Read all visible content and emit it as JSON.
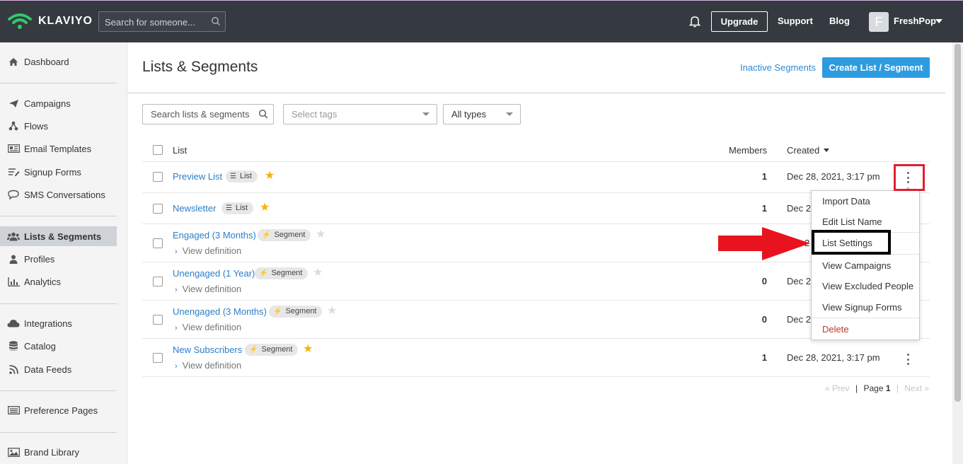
{
  "app": {
    "brand": "KLAVIYO",
    "brand_color": "#34c76b"
  },
  "topbar": {
    "search_placeholder": "Search for someone...",
    "upgrade_label": "Upgrade",
    "support_label": "Support",
    "blog_label": "Blog",
    "avatar_initial": "F",
    "account_name": "FreshPop"
  },
  "sidebar": {
    "items": [
      {
        "label": "Dashboard",
        "icon": "home-icon"
      },
      {
        "label": "Campaigns",
        "icon": "paper-plane-icon"
      },
      {
        "label": "Flows",
        "icon": "flows-icon"
      },
      {
        "label": "Email Templates",
        "icon": "newspaper-icon"
      },
      {
        "label": "Signup Forms",
        "icon": "form-list-icon"
      },
      {
        "label": "SMS Conversations",
        "icon": "chat-bubble-icon"
      },
      {
        "label": "Lists & Segments",
        "icon": "users-icon",
        "active": true
      },
      {
        "label": "Profiles",
        "icon": "user-icon"
      },
      {
        "label": "Analytics",
        "icon": "bar-chart-icon"
      },
      {
        "label": "Integrations",
        "icon": "cloud-icon"
      },
      {
        "label": "Catalog",
        "icon": "database-icon"
      },
      {
        "label": "Data Feeds",
        "icon": "rss-icon"
      },
      {
        "label": "Preference Pages",
        "icon": "list-page-icon"
      },
      {
        "label": "Brand Library",
        "icon": "image-icon"
      }
    ]
  },
  "header": {
    "title": "Lists & Segments",
    "inactive_link": "Inactive Segments",
    "create_button": "Create List / Segment"
  },
  "filters": {
    "search_placeholder": "Search lists & segments",
    "tags_placeholder": "Select tags",
    "type_selected": "All types"
  },
  "table": {
    "columns": {
      "list": "List",
      "members": "Members",
      "created": "Created"
    },
    "view_definition": "View definition",
    "rows": [
      {
        "name": "Preview List",
        "tag": "List",
        "starred": true,
        "members": "1",
        "created": "Dec 28, 2021, 3:17 pm"
      },
      {
        "name": "Newsletter",
        "tag": "List",
        "starred": true,
        "members": "1",
        "created": "Dec 2"
      },
      {
        "name": "Engaged (3 Months)",
        "tag": "Segment",
        "starred": false,
        "members": "",
        "created": "2"
      },
      {
        "name": "Unengaged (1 Year)",
        "tag": "Segment",
        "starred": false,
        "members": "0",
        "created": "Dec 2"
      },
      {
        "name": "Unengaged (3 Months)",
        "tag": "Segment",
        "starred": false,
        "members": "0",
        "created": "Dec 2"
      },
      {
        "name": "New Subscribers",
        "tag": "Segment",
        "starred": true,
        "members": "1",
        "created": "Dec 28, 2021, 3:17 pm"
      }
    ]
  },
  "menu": {
    "items": [
      "Import Data",
      "Edit List Name",
      "List Settings",
      "View Campaigns",
      "View Excluded People",
      "View Signup Forms",
      "Delete"
    ]
  },
  "pager": {
    "prev": "« Prev",
    "sep": "|",
    "page_prefix": "Page",
    "page_num": "1",
    "next": "Next »"
  }
}
